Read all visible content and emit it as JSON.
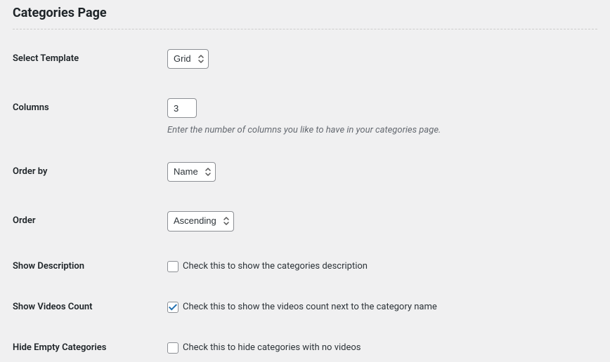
{
  "section": {
    "title": "Categories Page"
  },
  "fields": {
    "template": {
      "label": "Select Template",
      "value": "Grid"
    },
    "columns": {
      "label": "Columns",
      "value": "3",
      "help": "Enter the number of columns you like to have in your categories page."
    },
    "orderby": {
      "label": "Order by",
      "value": "Name"
    },
    "order": {
      "label": "Order",
      "value": "Ascending"
    },
    "show_description": {
      "label": "Show Description",
      "checkbox_label": "Check this to show the categories description",
      "checked": false
    },
    "show_videos_count": {
      "label": "Show Videos Count",
      "checkbox_label": "Check this to show the videos count next to the category name",
      "checked": true
    },
    "hide_empty": {
      "label": "Hide Empty Categories",
      "checkbox_label": "Check this to hide categories with no videos",
      "checked": false
    }
  }
}
